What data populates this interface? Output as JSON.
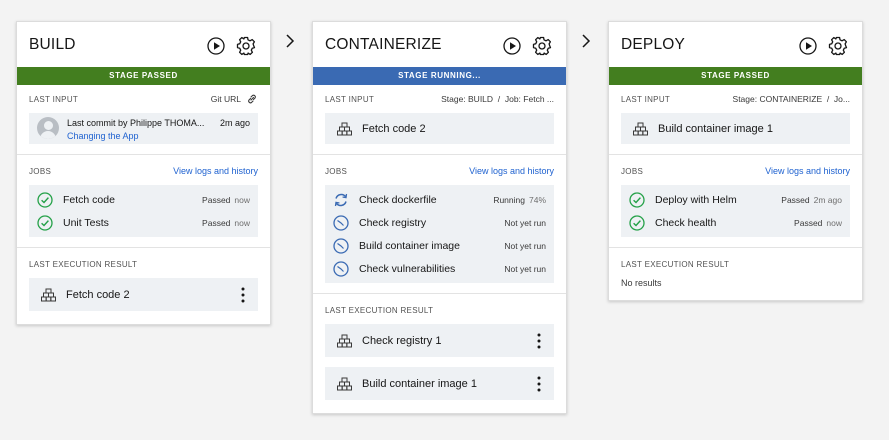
{
  "stages": {
    "build": {
      "title": "BUILD",
      "status": "STAGE PASSED",
      "last_input_label": "LAST INPUT",
      "last_input_right": "Git URL",
      "commit_text": "Last commit by Philippe THOMA...",
      "commit_time": "2m ago",
      "commit_message": "Changing the App",
      "jobs_label": "JOBS",
      "jobs_link": "View logs and history",
      "jobs": [
        {
          "name": "Fetch code",
          "status": "Passed",
          "time": "now"
        },
        {
          "name": "Unit Tests",
          "status": "Passed",
          "time": "now"
        }
      ],
      "result_label": "LAST EXECUTION RESULT",
      "results": [
        "Fetch code 2"
      ]
    },
    "containerize": {
      "title": "CONTAINERIZE",
      "status": "STAGE RUNNING...",
      "last_input_label": "LAST INPUT",
      "last_input_right": "Stage: BUILD  /  Job: Fetch ...",
      "input_item": "Fetch code 2",
      "jobs_label": "JOBS",
      "jobs_link": "View logs and history",
      "jobs": [
        {
          "name": "Check dockerfile",
          "status": "Running",
          "time": "74%"
        },
        {
          "name": "Check registry",
          "status": "Not yet run",
          "time": ""
        },
        {
          "name": "Build container image",
          "status": "Not yet run",
          "time": ""
        },
        {
          "name": "Check vulnerabilities",
          "status": "Not yet run",
          "time": ""
        }
      ],
      "result_label": "LAST EXECUTION RESULT",
      "results": [
        "Check registry 1",
        "Build container image 1"
      ]
    },
    "deploy": {
      "title": "DEPLOY",
      "status": "STAGE PASSED",
      "last_input_label": "LAST INPUT",
      "last_input_right": "Stage: CONTAINERIZE  /  Jo...",
      "input_item": "Build container image 1",
      "jobs_label": "JOBS",
      "jobs_link": "View logs and history",
      "jobs": [
        {
          "name": "Deploy with Helm",
          "status": "Passed",
          "time": "2m ago"
        },
        {
          "name": "Check health",
          "status": "Passed",
          "time": "now"
        }
      ],
      "result_label": "LAST EXECUTION RESULT",
      "no_results": "No results"
    }
  },
  "colors": {
    "passed": "#437e1f",
    "running": "#3a6ab3",
    "link": "#1f62d0",
    "check": "#24a148"
  },
  "icons": {
    "run": "play-circle-icon",
    "settings": "gear-icon",
    "artifact": "stack-icon",
    "passed": "checkmark-circle-icon",
    "running": "renew-icon",
    "pending": "clock-icon",
    "more": "overflow-menu-icon",
    "link": "link-icon",
    "arrow": "chevron-right-icon"
  }
}
